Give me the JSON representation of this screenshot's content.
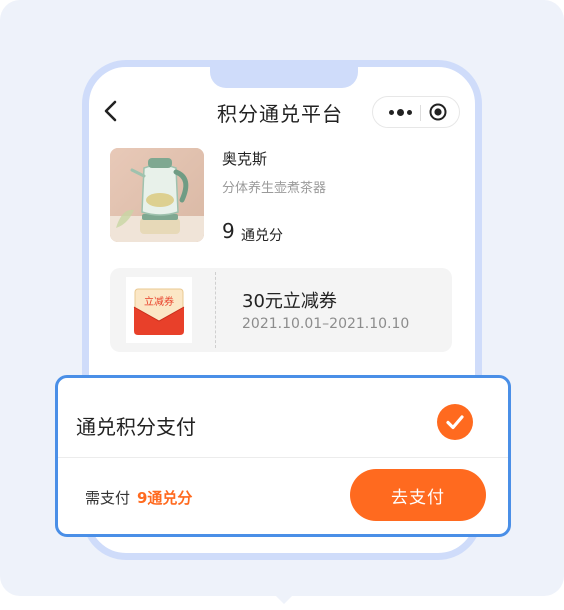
{
  "nav": {
    "title": "积分通兑平台",
    "back_icon": "chevron-left-icon",
    "more_icon": "more-dots-icon",
    "close_icon": "target-circle-icon"
  },
  "product": {
    "image_icon": "tea-kettle-image",
    "name": "奥克斯",
    "description": "分体养生壶煮茶器",
    "points_value": "9",
    "points_unit": "通兑分"
  },
  "coupon": {
    "icon_text": "立减券",
    "title": "30元立减券",
    "validity": "2021.10.01–2021.10.10"
  },
  "payment": {
    "method_label": "通兑积分支付",
    "selected": true,
    "need_label": "需支付",
    "need_amount": "9通兑分",
    "pay_button": "去支付"
  },
  "colors": {
    "accent": "#ff6a1f",
    "frame": "#cfdcfa",
    "highlight_border": "#4a8fe7",
    "background": "#eef2fa"
  }
}
